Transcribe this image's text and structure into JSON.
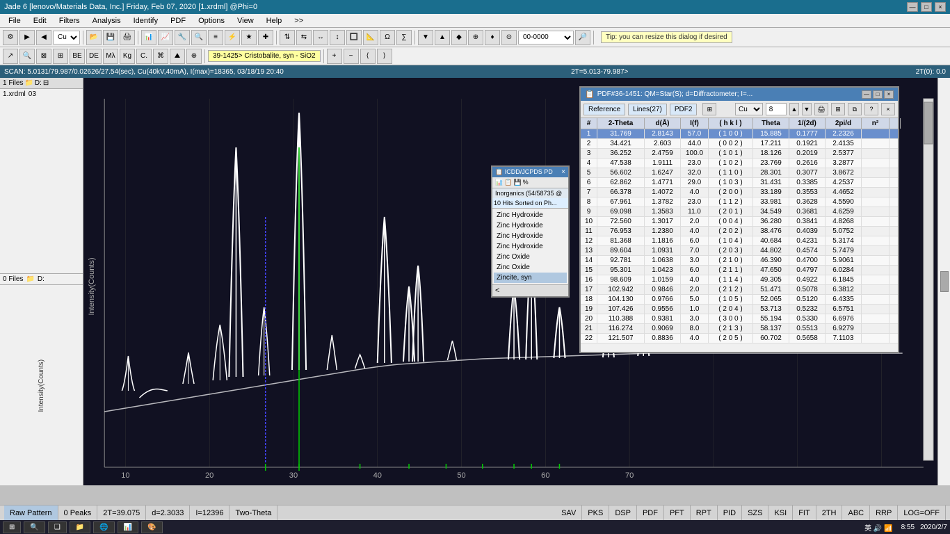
{
  "app": {
    "title": "Jade 6 [lenovo/Materials Data, Inc.] Friday, Feb 07, 2020 [1.xrdml] @Phi=0",
    "win_controls": [
      "—",
      "□",
      "×"
    ]
  },
  "menu": {
    "items": [
      "File",
      "Edit",
      "Filters",
      "Analysis",
      "Identify",
      "PDF",
      "Options",
      "View",
      "Help",
      ">>"
    ]
  },
  "toolbar": {
    "combo1": "Cu",
    "combo2": "1.xrdml",
    "phi": "@Phi=0",
    "tip": "Tip: you can resize this dialog if desired",
    "combo3": "00-0000"
  },
  "scan_bar": {
    "text": "SCAN: 5.0131/79.987/0.02626/27.54(sec), Cu(40kV,40mA), I(max)=18365, 03/18/19 20:40",
    "right": "2T=5.013-79.987>",
    "right2": "2T(0): 0.0"
  },
  "files": {
    "section1_header": "1 Files",
    "items": [
      {
        "name": "1.xrdml",
        "value": "03"
      }
    ]
  },
  "files2": {
    "section2_header": "0 Files"
  },
  "phase_label": "39-1425> Cristobalite, syn - SiO2",
  "chart": {
    "y_label": "Intensity(Counts)",
    "x_ticks": [
      "10",
      "20",
      "30",
      "40",
      "50",
      "60",
      "70"
    ]
  },
  "pdf_popup": {
    "header": "ICDD/JCPDS PD",
    "sub": "Inorganics (54/58735 @",
    "sort_label": "10 Hits Sorted on Ph...",
    "items": [
      "Zinc Hydroxide",
      "Zinc Hydroxide",
      "Zinc Hydroxide",
      "Zinc Hydroxide",
      "Zinc Oxide",
      "Zinc Oxide",
      "Zincite, syn"
    ],
    "arrow": "<"
  },
  "pdf_dialog": {
    "title": "PDF#36-1451: QM=Star(S); d=Diffractometer; I=...",
    "tabs": [
      "Reference",
      "Lines(27)",
      "PDF2"
    ],
    "element": "Cu",
    "number": "8",
    "columns": [
      "#",
      "2-Theta",
      "d(Å)",
      "I(f)",
      "( h k l )",
      "Theta",
      "1/(2d)",
      "2pi/d",
      "n²"
    ],
    "rows": [
      {
        "n": "1",
        "two_theta": "31.769",
        "d": "2.8143",
        "I": "57.0",
        "hkl": "( 1 0 0 )",
        "theta": "15.885",
        "inv2d": "0.1777",
        "twopid": "2.2326",
        "n2": ""
      },
      {
        "n": "2",
        "two_theta": "34.421",
        "d": "2.603",
        "I": "44.0",
        "hkl": "( 0 0 2 )",
        "theta": "17.211",
        "inv2d": "0.1921",
        "twopid": "2.4135",
        "n2": ""
      },
      {
        "n": "3",
        "two_theta": "36.252",
        "d": "2.4759",
        "I": "100.0",
        "hkl": "( 1 0 1 )",
        "theta": "18.126",
        "inv2d": "0.2019",
        "twopid": "2.5377",
        "n2": ""
      },
      {
        "n": "4",
        "two_theta": "47.538",
        "d": "1.9111",
        "I": "23.0",
        "hkl": "( 1 0 2 )",
        "theta": "23.769",
        "inv2d": "0.2616",
        "twopid": "3.2877",
        "n2": ""
      },
      {
        "n": "5",
        "two_theta": "56.602",
        "d": "1.6247",
        "I": "32.0",
        "hkl": "( 1 1 0 )",
        "theta": "28.301",
        "inv2d": "0.3077",
        "twopid": "3.8672",
        "n2": ""
      },
      {
        "n": "6",
        "two_theta": "62.862",
        "d": "1.4771",
        "I": "29.0",
        "hkl": "( 1 0 3 )",
        "theta": "31.431",
        "inv2d": "0.3385",
        "twopid": "4.2537",
        "n2": ""
      },
      {
        "n": "7",
        "two_theta": "66.378",
        "d": "1.4072",
        "I": "4.0",
        "hkl": "( 2 0 0 )",
        "theta": "33.189",
        "inv2d": "0.3553",
        "twopid": "4.4652",
        "n2": ""
      },
      {
        "n": "8",
        "two_theta": "67.961",
        "d": "1.3782",
        "I": "23.0",
        "hkl": "( 1 1 2 )",
        "theta": "33.981",
        "inv2d": "0.3628",
        "twopid": "4.5590",
        "n2": ""
      },
      {
        "n": "9",
        "two_theta": "69.098",
        "d": "1.3583",
        "I": "11.0",
        "hkl": "( 2 0 1 )",
        "theta": "34.549",
        "inv2d": "0.3681",
        "twopid": "4.6259",
        "n2": ""
      },
      {
        "n": "10",
        "two_theta": "72.560",
        "d": "1.3017",
        "I": "2.0",
        "hkl": "( 0 0 4 )",
        "theta": "36.280",
        "inv2d": "0.3841",
        "twopid": "4.8268",
        "n2": ""
      },
      {
        "n": "11",
        "two_theta": "76.953",
        "d": "1.2380",
        "I": "4.0",
        "hkl": "( 2 0 2 )",
        "theta": "38.476",
        "inv2d": "0.4039",
        "twopid": "5.0752",
        "n2": ""
      },
      {
        "n": "12",
        "two_theta": "81.368",
        "d": "1.1816",
        "I": "6.0",
        "hkl": "( 1 0 4 )",
        "theta": "40.684",
        "inv2d": "0.4231",
        "twopid": "5.3174",
        "n2": ""
      },
      {
        "n": "13",
        "two_theta": "89.604",
        "d": "1.0931",
        "I": "7.0",
        "hkl": "( 2 0 3 )",
        "theta": "44.802",
        "inv2d": "0.4574",
        "twopid": "5.7479",
        "n2": ""
      },
      {
        "n": "14",
        "two_theta": "92.781",
        "d": "1.0638",
        "I": "3.0",
        "hkl": "( 2 1 0 )",
        "theta": "46.390",
        "inv2d": "0.4700",
        "twopid": "5.9061",
        "n2": ""
      },
      {
        "n": "15",
        "two_theta": "95.301",
        "d": "1.0423",
        "I": "6.0",
        "hkl": "( 2 1 1 )",
        "theta": "47.650",
        "inv2d": "0.4797",
        "twopid": "6.0284",
        "n2": ""
      },
      {
        "n": "16",
        "two_theta": "98.609",
        "d": "1.0159",
        "I": "4.0",
        "hkl": "( 1 1 4 )",
        "theta": "49.305",
        "inv2d": "0.4922",
        "twopid": "6.1845",
        "n2": ""
      },
      {
        "n": "17",
        "two_theta": "102.942",
        "d": "0.9846",
        "I": "2.0",
        "hkl": "( 2 1 2 )",
        "theta": "51.471",
        "inv2d": "0.5078",
        "twopid": "6.3812",
        "n2": ""
      },
      {
        "n": "18",
        "two_theta": "104.130",
        "d": "0.9766",
        "I": "5.0",
        "hkl": "( 1 0 5 )",
        "theta": "52.065",
        "inv2d": "0.5120",
        "twopid": "6.4335",
        "n2": ""
      },
      {
        "n": "19",
        "two_theta": "107.426",
        "d": "0.9556",
        "I": "1.0",
        "hkl": "( 2 0 4 )",
        "theta": "53.713",
        "inv2d": "0.5232",
        "twopid": "6.5751",
        "n2": ""
      },
      {
        "n": "20",
        "two_theta": "110.388",
        "d": "0.9381",
        "I": "3.0",
        "hkl": "( 3 0 0 )",
        "theta": "55.194",
        "inv2d": "0.5330",
        "twopid": "6.6976",
        "n2": ""
      },
      {
        "n": "21",
        "two_theta": "116.274",
        "d": "0.9069",
        "I": "8.0",
        "hkl": "( 2 1 3 )",
        "theta": "58.137",
        "inv2d": "0.5513",
        "twopid": "6.9279",
        "n2": ""
      },
      {
        "n": "22",
        "two_theta": "121.507",
        "d": "0.8836",
        "I": "4.0",
        "hkl": "( 2 0 5 )",
        "theta": "60.702",
        "inv2d": "0.5658",
        "twopid": "7.1103",
        "n2": ""
      }
    ]
  },
  "status": {
    "raw_pattern": "Raw Pattern",
    "peaks": "0 Peaks",
    "two_theta": "2T=39.075",
    "d": "d=2.3033",
    "intensity": "I=12396",
    "two_theta_label": "Two-Theta",
    "buttons": [
      "SAV",
      "PKS",
      "DSP",
      "PDF",
      "PFT",
      "RPT",
      "PID",
      "SZS",
      "KSI",
      "FIT",
      "2TH",
      "ABC",
      "RRP"
    ],
    "log": "LOG=OFF"
  },
  "taskbar": {
    "time": "8:55",
    "date": "2020/2/7",
    "start_icon": "⊞",
    "search_icon": "🔍",
    "task_view": "❑",
    "apps": [
      "⊞",
      "🔍",
      "❑",
      "📁",
      "🌐",
      "📊",
      "🎨"
    ],
    "tray": "英 🔊 📶"
  }
}
